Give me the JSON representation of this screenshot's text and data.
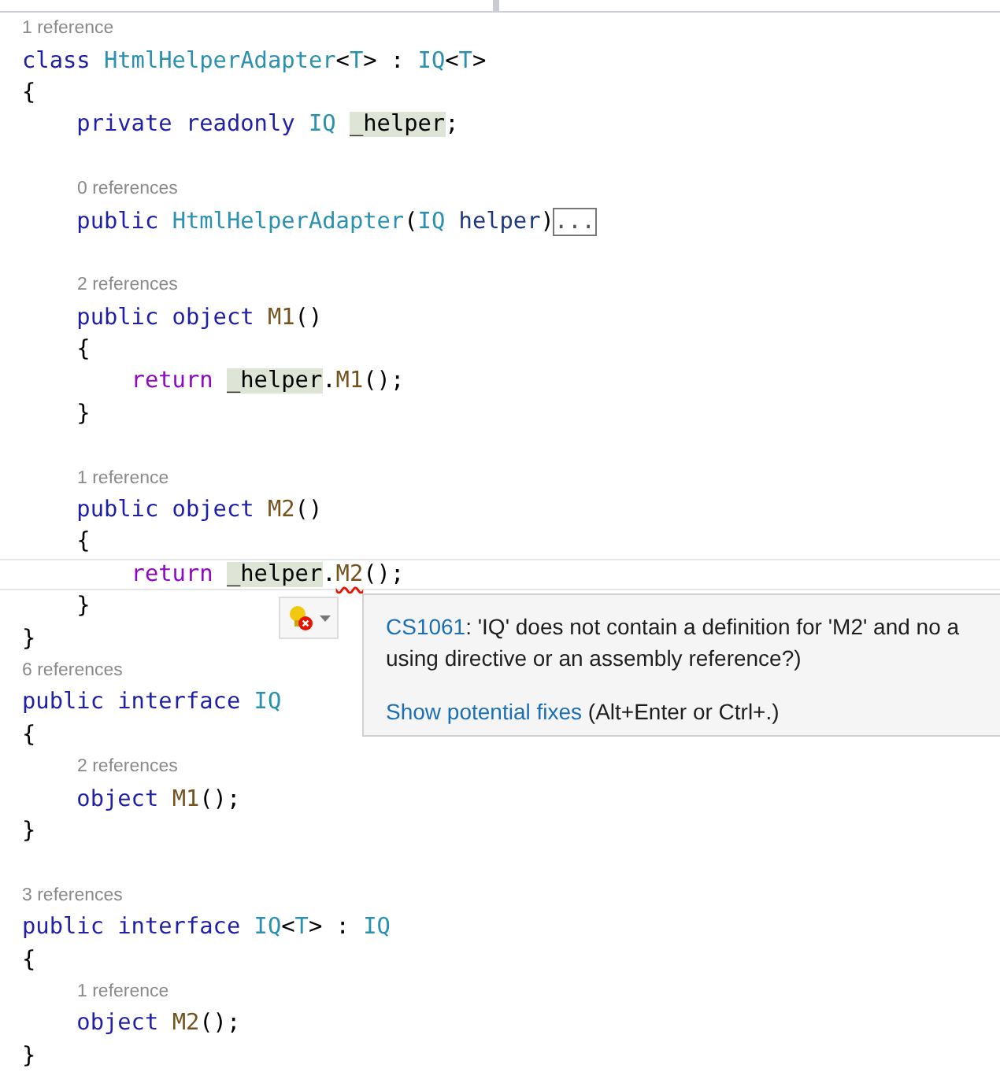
{
  "lines": [
    {
      "kind": "lens",
      "text": "1 reference",
      "indented": false
    },
    {
      "kind": "code",
      "current": false,
      "tokens": [
        {
          "kind": "keyword",
          "text": "class "
        },
        {
          "kind": "type",
          "text": "HtmlHelperAdapter"
        },
        {
          "kind": "plain",
          "text": "<"
        },
        {
          "kind": "type",
          "text": "T"
        },
        {
          "kind": "plain",
          "text": "> : "
        },
        {
          "kind": "type",
          "text": "IQ"
        },
        {
          "kind": "plain",
          "text": "<"
        },
        {
          "kind": "type",
          "text": "T"
        },
        {
          "kind": "plain",
          "text": ">"
        }
      ]
    },
    {
      "kind": "code",
      "current": false,
      "tokens": [
        {
          "kind": "plain",
          "text": "{"
        }
      ]
    },
    {
      "kind": "code",
      "current": false,
      "tokens": [
        {
          "kind": "keyword",
          "text": "    private readonly "
        },
        {
          "kind": "type",
          "text": "IQ "
        },
        {
          "kind": "highlight",
          "text": "_helper"
        },
        {
          "kind": "plain",
          "text": ";"
        }
      ]
    },
    {
      "kind": "blank"
    },
    {
      "kind": "lens",
      "text": "0 references",
      "indented": true
    },
    {
      "kind": "code",
      "current": false,
      "tokens": [
        {
          "kind": "keyword",
          "text": "    public "
        },
        {
          "kind": "type",
          "text": "HtmlHelperAdapter"
        },
        {
          "kind": "plain",
          "text": "("
        },
        {
          "kind": "type",
          "text": "IQ "
        },
        {
          "kind": "param",
          "text": "helper"
        },
        {
          "kind": "plain",
          "text": ")"
        },
        {
          "kind": "collapsed",
          "text": "..."
        }
      ]
    },
    {
      "kind": "blank"
    },
    {
      "kind": "lens",
      "text": "2 references",
      "indented": true
    },
    {
      "kind": "code",
      "current": false,
      "tokens": [
        {
          "kind": "keyword",
          "text": "    public object "
        },
        {
          "kind": "method",
          "text": "M1"
        },
        {
          "kind": "plain",
          "text": "()"
        }
      ]
    },
    {
      "kind": "code",
      "current": false,
      "tokens": [
        {
          "kind": "plain",
          "text": "    {"
        }
      ]
    },
    {
      "kind": "code",
      "current": false,
      "tokens": [
        {
          "kind": "control",
          "text": "        return "
        },
        {
          "kind": "highlight",
          "text": "_helper"
        },
        {
          "kind": "plain",
          "text": "."
        },
        {
          "kind": "method",
          "text": "M1"
        },
        {
          "kind": "plain",
          "text": "();"
        }
      ]
    },
    {
      "kind": "code",
      "current": false,
      "tokens": [
        {
          "kind": "plain",
          "text": "    }"
        }
      ]
    },
    {
      "kind": "blank"
    },
    {
      "kind": "lens",
      "text": "1 reference",
      "indented": true
    },
    {
      "kind": "code",
      "current": false,
      "tokens": [
        {
          "kind": "keyword",
          "text": "    public object "
        },
        {
          "kind": "method",
          "text": "M2"
        },
        {
          "kind": "plain",
          "text": "()"
        }
      ]
    },
    {
      "kind": "code",
      "current": false,
      "tokens": [
        {
          "kind": "plain",
          "text": "    {"
        }
      ]
    },
    {
      "kind": "code",
      "current": true,
      "tokens": [
        {
          "kind": "control",
          "text": "        return "
        },
        {
          "kind": "highlight",
          "text": "_helper"
        },
        {
          "kind": "plain",
          "text": "."
        },
        {
          "kind": "error",
          "text": "M2"
        },
        {
          "kind": "plain",
          "text": "();"
        }
      ]
    },
    {
      "kind": "code",
      "current": false,
      "tokens": [
        {
          "kind": "plain",
          "text": "    }"
        }
      ]
    },
    {
      "kind": "code",
      "current": false,
      "tokens": [
        {
          "kind": "plain",
          "text": "}"
        }
      ]
    },
    {
      "kind": "lens",
      "text": "6 references",
      "indented": false
    },
    {
      "kind": "code",
      "current": false,
      "tokens": [
        {
          "kind": "keyword",
          "text": "public interface "
        },
        {
          "kind": "type",
          "text": "IQ"
        }
      ]
    },
    {
      "kind": "code",
      "current": false,
      "tokens": [
        {
          "kind": "plain",
          "text": "{"
        }
      ]
    },
    {
      "kind": "lens",
      "text": "2 references",
      "indented": true
    },
    {
      "kind": "code",
      "current": false,
      "tokens": [
        {
          "kind": "keyword",
          "text": "    object "
        },
        {
          "kind": "method",
          "text": "M1"
        },
        {
          "kind": "plain",
          "text": "();"
        }
      ]
    },
    {
      "kind": "code",
      "current": false,
      "tokens": [
        {
          "kind": "plain",
          "text": "}"
        }
      ]
    },
    {
      "kind": "blank"
    },
    {
      "kind": "lens",
      "text": "3 references",
      "indented": false
    },
    {
      "kind": "code",
      "current": false,
      "tokens": [
        {
          "kind": "keyword",
          "text": "public interface "
        },
        {
          "kind": "type",
          "text": "IQ"
        },
        {
          "kind": "plain",
          "text": "<"
        },
        {
          "kind": "type",
          "text": "T"
        },
        {
          "kind": "plain",
          "text": "> : "
        },
        {
          "kind": "type",
          "text": "IQ"
        }
      ]
    },
    {
      "kind": "code",
      "current": false,
      "tokens": [
        {
          "kind": "plain",
          "text": "{"
        }
      ]
    },
    {
      "kind": "lens",
      "text": "1 reference",
      "indented": true
    },
    {
      "kind": "code",
      "current": false,
      "tokens": [
        {
          "kind": "keyword",
          "text": "    object "
        },
        {
          "kind": "method",
          "text": "M2"
        },
        {
          "kind": "plain",
          "text": "();"
        }
      ]
    },
    {
      "kind": "code",
      "current": false,
      "tokens": [
        {
          "kind": "plain",
          "text": "}"
        }
      ]
    }
  ],
  "quick_info": {
    "code": "CS1061",
    "message_line_1": ": 'IQ' does not contain a definition for 'M2' and no a",
    "message_line_2": "using directive or an assembly reference?)",
    "fix_link": "Show potential fixes",
    "fix_shortcut": "(Alt+Enter or Ctrl+.)"
  }
}
